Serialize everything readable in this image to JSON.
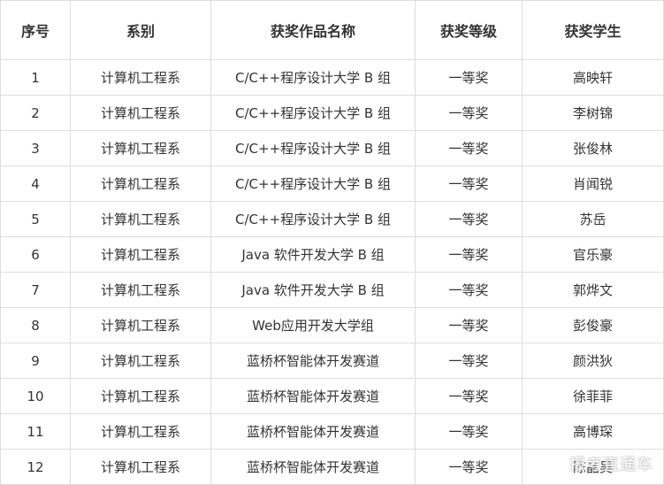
{
  "table": {
    "headers": [
      "序号",
      "系别",
      "获奖作品名称",
      "获奖等级",
      "获奖学生"
    ],
    "rows": [
      [
        "1",
        "计算机工程系",
        "C/C++程序设计大学 B 组",
        "一等奖",
        "高映轩"
      ],
      [
        "2",
        "计算机工程系",
        "C/C++程序设计大学 B 组",
        "一等奖",
        "李树锦"
      ],
      [
        "3",
        "计算机工程系",
        "C/C++程序设计大学 B 组",
        "一等奖",
        "张俊林"
      ],
      [
        "4",
        "计算机工程系",
        "C/C++程序设计大学 B 组",
        "一等奖",
        "肖闻锐"
      ],
      [
        "5",
        "计算机工程系",
        "C/C++程序设计大学 B 组",
        "一等奖",
        "苏岳"
      ],
      [
        "6",
        "计算机工程系",
        "Java 软件开发大学 B 组",
        "一等奖",
        "官乐豪"
      ],
      [
        "7",
        "计算机工程系",
        "Java 软件开发大学 B 组",
        "一等奖",
        "郭烨文"
      ],
      [
        "8",
        "计算机工程系",
        "Web应用开发大学组",
        "一等奖",
        "彭俊豪"
      ],
      [
        "9",
        "计算机工程系",
        "蓝桥杯智能体开发赛道",
        "一等奖",
        "颜洪狄"
      ],
      [
        "10",
        "计算机工程系",
        "蓝桥杯智能体开发赛道",
        "一等奖",
        "徐菲菲"
      ],
      [
        "11",
        "计算机工程系",
        "蓝桥杯智能体开发赛道",
        "一等奖",
        "高博琛"
      ],
      [
        "12",
        "计算机工程系",
        "蓝桥杯智能体开发赛道",
        "一等奖",
        "陈晶吴"
      ]
    ]
  },
  "watermark": "报考直通车"
}
